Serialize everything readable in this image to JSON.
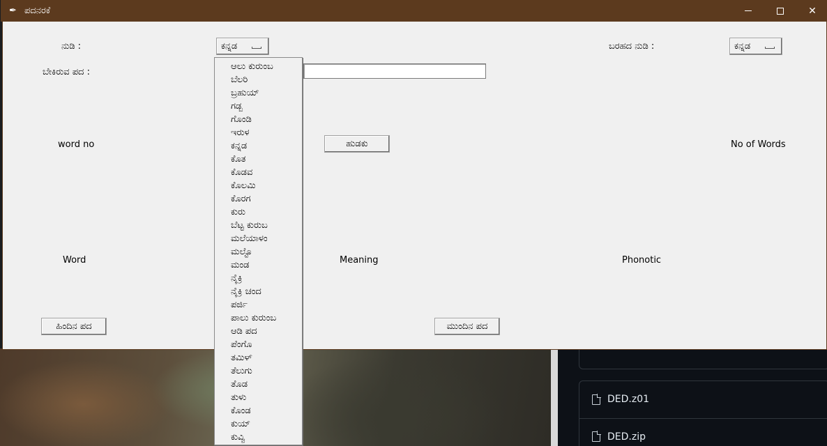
{
  "window": {
    "title": "ಪದನರಕೆ"
  },
  "form": {
    "lang_label": "ನುಡಿ :",
    "lang_value": "ಕನ್ನಡ",
    "script_label": "ಬರಹದ ನುಡಿ :",
    "script_value": "ಕನ್ನಡ",
    "word_label": "ಬೇಕಿರುವ ಪದ :",
    "word_input_value": "",
    "word_no_label": "word no",
    "search_button": "ಹುಡಕು",
    "no_of_words_label": "No of Words",
    "col_word": "Word",
    "col_meaning": "Meaning",
    "col_phonetic": "Phonotic",
    "prev_button": "ಹಿಂದಿನ ಪದ",
    "next_button": "ಮುಂದಿನ ಪದ"
  },
  "dropdown": {
    "items": [
      "ಆಲು ಕುರುಂಬ",
      "ಬೆಲರಿ",
      "ಬ್ರಹುಯ್",
      "ಗಡ್ಬ",
      "ಗೊಂಡಿ",
      "ಇರುಳ",
      "ಕನ್ನಡ",
      "ಕೊತ",
      "ಕೊಡವ",
      "ಕೊಲಮಿ",
      "ಕೊರಗ",
      "ಕುರು",
      "ಬೆಟ್ಟ ಕುರುಬ",
      "ಮಲೆಯಾಳಂ",
      "ಮಲ್ಟೊ",
      "ಮಂಡ",
      "ನೈಕ್ರಿ",
      "ನೈಕ್ರಿ ಚಂದ",
      "ಪರ್ಜಿ",
      "ಪಾಲು ಕುರುಂಬ",
      "ಆಡಿ ಪದ",
      "ಪೆಂಗೊ",
      "ತಮಿಳ್",
      "ತೆಲುಗು",
      "ತೊಡ",
      "ತುಳು",
      "ಕೊಂಡ",
      "ಕುಯ್",
      "ಕುವ್ವಿ"
    ]
  },
  "background": {
    "files": [
      "DED.z01",
      "DED.zip"
    ]
  }
}
